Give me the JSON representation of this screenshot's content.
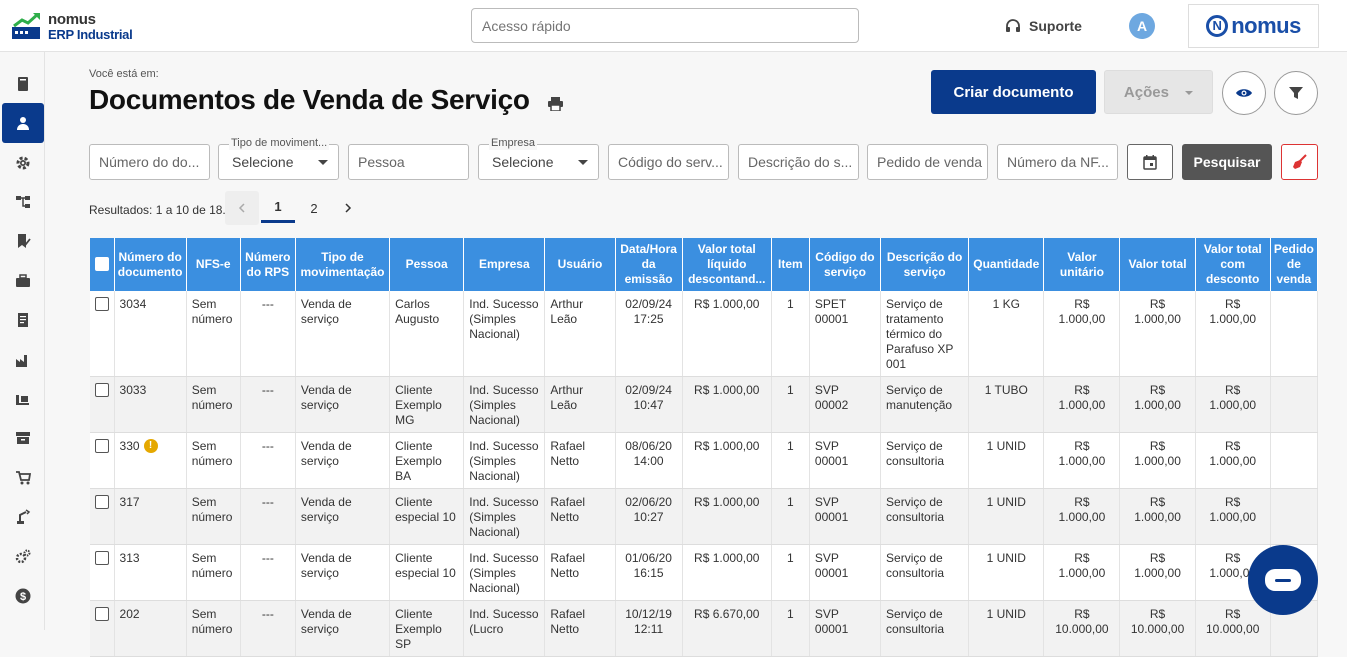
{
  "app": {
    "logo_line1": "nomus",
    "logo_line2": "ERP Industrial",
    "brand": "nomus",
    "brand_initial": "N"
  },
  "header": {
    "quick_placeholder": "Acesso rápido",
    "support_label": "Suporte",
    "avatar_initial": "A"
  },
  "sidebar": {
    "items": [
      {
        "icon": "book-icon"
      },
      {
        "icon": "user-icon",
        "active": true
      },
      {
        "icon": "gear-icon"
      },
      {
        "icon": "hierarchy-icon"
      },
      {
        "icon": "bookmark-check-icon"
      },
      {
        "icon": "briefcase-icon"
      },
      {
        "icon": "ledger-icon"
      },
      {
        "icon": "factory-icon"
      },
      {
        "icon": "warehouse-icon"
      },
      {
        "icon": "archive-icon"
      },
      {
        "icon": "cart-icon"
      },
      {
        "icon": "robot-arm-icon"
      },
      {
        "icon": "gears-icon"
      },
      {
        "icon": "dollar-icon"
      }
    ]
  },
  "page": {
    "breadcrumb": "Você está em:",
    "title": "Documentos de Venda de Serviço"
  },
  "actions": {
    "create_label": "Criar documento",
    "actions_label": "Ações"
  },
  "filters": {
    "numero_doc": "Número do do...",
    "tipo_mov_label": "Tipo de moviment...",
    "tipo_mov_value": "Selecione",
    "pessoa": "Pessoa",
    "empresa_label": "Empresa",
    "empresa_value": "Selecione",
    "codigo_serv": "Código do serv...",
    "descricao_serv": "Descrição do s...",
    "pedido_venda": "Pedido de venda",
    "numero_nf": "Número da NF...",
    "search_label": "Pesquisar"
  },
  "results": {
    "text": "Resultados: 1 a 10 de 18.",
    "pages": [
      "1",
      "2"
    ],
    "current_page": "1"
  },
  "table": {
    "headers": [
      "Número do documento",
      "NFS-e",
      "Número do RPS",
      "Tipo de movimentação",
      "Pessoa",
      "Empresa",
      "Usuário",
      "Data/Hora da emissão",
      "Valor total líquido descontand...",
      "Item",
      "Código do serviço",
      "Descrição do serviço",
      "Quantidade",
      "Valor unitário",
      "Valor total",
      "Valor total com desconto",
      "Pedido de venda"
    ],
    "rows": [
      {
        "num": "3034",
        "nfse": "Sem número",
        "rps": "---",
        "tipo": "Venda de serviço",
        "pessoa": "Carlos Augusto",
        "empresa": "Ind. Sucesso (Simples Nacional)",
        "usuario": "Arthur Leão",
        "data": "02/09/24 17:25",
        "liquido": "R$ 1.000,00",
        "item": "1",
        "codigo": "SPET 00001",
        "descricao": "Serviço de tratamento térmico do Parafuso XP 001",
        "qtd": "1 KG",
        "unit": "R$ 1.000,00",
        "total": "R$ 1.000,00",
        "desconto": "R$ 1.000,00",
        "pedido": ""
      },
      {
        "num": "3033",
        "nfse": "Sem número",
        "rps": "---",
        "tipo": "Venda de serviço",
        "pessoa": "Cliente Exemplo MG",
        "empresa": "Ind. Sucesso (Simples Nacional)",
        "usuario": "Arthur Leão",
        "data": "02/09/24 10:47",
        "liquido": "R$ 1.000,00",
        "item": "1",
        "codigo": "SVP 00002",
        "descricao": "Serviço de manutenção",
        "qtd": "1 TUBO",
        "unit": "R$ 1.000,00",
        "total": "R$ 1.000,00",
        "desconto": "R$ 1.000,00",
        "pedido": ""
      },
      {
        "num": "330",
        "warn": true,
        "nfse": "Sem número",
        "rps": "---",
        "tipo": "Venda de serviço",
        "pessoa": "Cliente Exemplo BA",
        "empresa": "Ind. Sucesso (Simples Nacional)",
        "usuario": "Rafael Netto",
        "data": "08/06/20 14:00",
        "liquido": "R$ 1.000,00",
        "item": "1",
        "codigo": "SVP 00001",
        "descricao": "Serviço de consultoria",
        "qtd": "1 UNID",
        "unit": "R$ 1.000,00",
        "total": "R$ 1.000,00",
        "desconto": "R$ 1.000,00",
        "pedido": ""
      },
      {
        "num": "317",
        "nfse": "Sem número",
        "rps": "---",
        "tipo": "Venda de serviço",
        "pessoa": "Cliente especial 10",
        "empresa": "Ind. Sucesso (Simples Nacional)",
        "usuario": "Rafael Netto",
        "data": "02/06/20 10:27",
        "liquido": "R$ 1.000,00",
        "item": "1",
        "codigo": "SVP 00001",
        "descricao": "Serviço de consultoria",
        "qtd": "1 UNID",
        "unit": "R$ 1.000,00",
        "total": "R$ 1.000,00",
        "desconto": "R$ 1.000,00",
        "pedido": ""
      },
      {
        "num": "313",
        "nfse": "Sem número",
        "rps": "---",
        "tipo": "Venda de serviço",
        "pessoa": "Cliente especial 10",
        "empresa": "Ind. Sucesso (Simples Nacional)",
        "usuario": "Rafael Netto",
        "data": "01/06/20 16:15",
        "liquido": "R$ 1.000,00",
        "item": "1",
        "codigo": "SVP 00001",
        "descricao": "Serviço de consultoria",
        "qtd": "1 UNID",
        "unit": "R$ 1.000,00",
        "total": "R$ 1.000,00",
        "desconto": "R$ 1.000,00",
        "pedido": ""
      },
      {
        "num": "202",
        "nfse": "Sem número",
        "rps": "---",
        "tipo": "Venda de serviço",
        "pessoa": "Cliente Exemplo SP",
        "empresa": "Ind. Sucesso (Lucro",
        "usuario": "Rafael Netto",
        "data": "10/12/19 12:11",
        "liquido": "R$ 6.670,00",
        "item": "1",
        "codigo": "SVP 00001",
        "descricao": "Serviço de consultoria",
        "qtd": "1 UNID",
        "unit": "R$ 10.000,00",
        "total": "R$ 10.000,00",
        "desconto": "R$ 10.000,00",
        "pedido": ""
      }
    ]
  },
  "colors": {
    "primary": "#0a3a8c",
    "header_blue": "#3b8fe0",
    "warning": "#e5a800",
    "danger": "#d33"
  }
}
